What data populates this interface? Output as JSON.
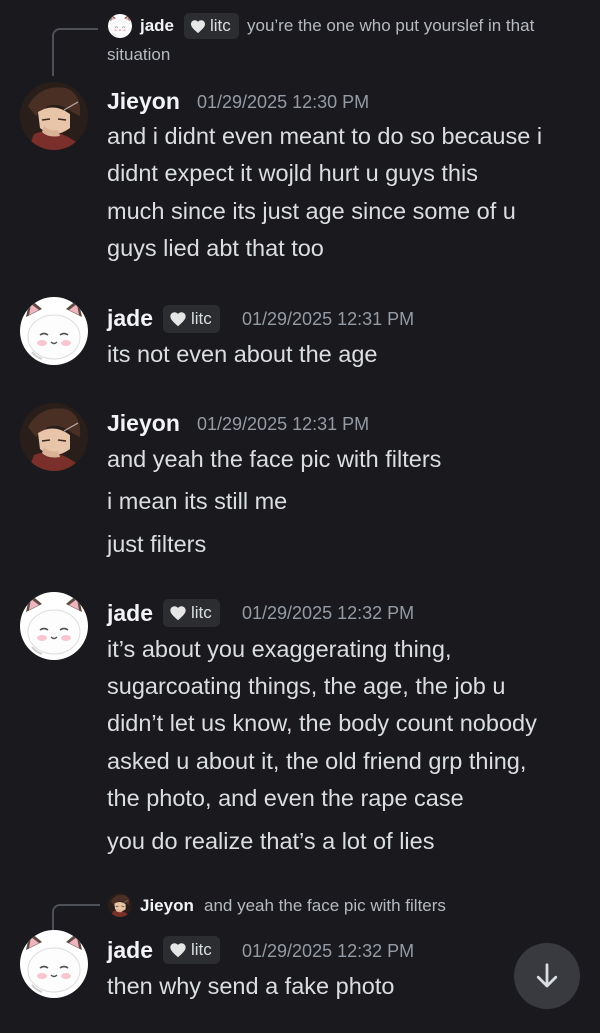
{
  "reply_top": {
    "name": "jade",
    "badge": "litc",
    "text_line1": "you’re the one who put yourslef in that",
    "text_line2": "situation"
  },
  "messages": [
    {
      "author": "Jieyon",
      "timestamp": "01/29/2025 12:30 PM",
      "lines": [
        "and i didnt even meant to do so because i",
        "didnt expect it wojld hurt u guys this",
        "much since its just age since some of u",
        "guys lied abt that too"
      ]
    },
    {
      "author": "jade",
      "badge": "litc",
      "timestamp": "01/29/2025 12:31 PM",
      "lines": [
        "its not even about the age"
      ]
    },
    {
      "author": "Jieyon",
      "timestamp": "01/29/2025 12:31 PM",
      "lines": [
        "and yeah the face pic with filters",
        "i mean its still me",
        "just filters"
      ]
    },
    {
      "author": "jade",
      "badge": "litc",
      "timestamp": "01/29/2025 12:32 PM",
      "lines": [
        "it’s about you exaggerating thing,",
        "sugarcoating things, the age, the job u",
        "didn’t let us know, the body count nobody",
        "asked u about it, the old friend grp thing,",
        "the photo, and even the rape case",
        "you do realize that’s a lot of lies"
      ]
    },
    {
      "author": "jade",
      "badge": "litc",
      "timestamp": "01/29/2025 12:32 PM",
      "lines": [
        "then why send a fake photo"
      ]
    }
  ],
  "reply_bottom": {
    "name": "Jieyon",
    "text": "and yeah the face pic with filters"
  },
  "icons": {
    "badge": "heart-icon",
    "scroll": "arrow-down-icon"
  },
  "colors": {
    "background": "#1a1a1e",
    "name": "#f2f3f5",
    "text": "#dbdee1",
    "timestamp": "#949ba4",
    "badge_bg": "#2b2d31"
  }
}
